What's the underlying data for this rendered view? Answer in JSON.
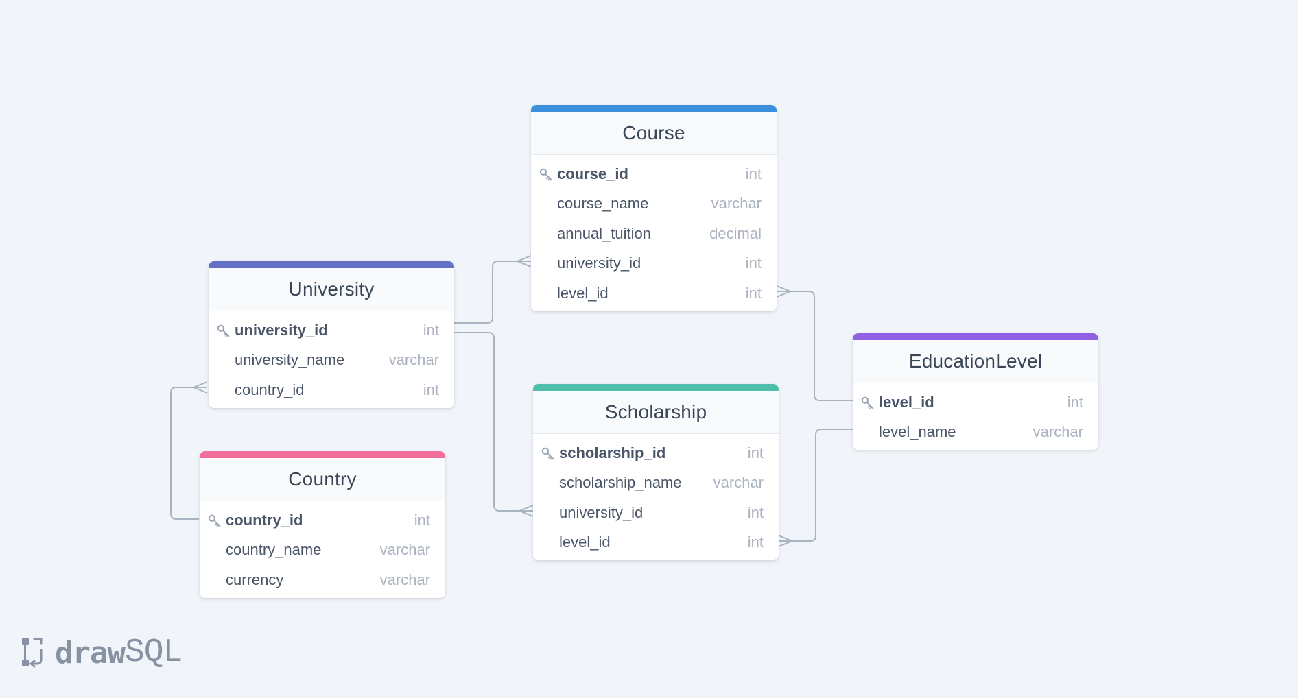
{
  "brand": {
    "name_bold": "draw",
    "name_light": "SQL"
  },
  "colors": {
    "course": "#3b8fdd",
    "university": "#6470c6",
    "scholarship": "#4fbfaa",
    "country": "#f26f9b",
    "educationlevel": "#9161e3",
    "connector": "#a9b4c2"
  },
  "tables": {
    "course": {
      "name": "Course",
      "columns": [
        {
          "name": "course_id",
          "type": "int",
          "pk": true
        },
        {
          "name": "course_name",
          "type": "varchar",
          "pk": false
        },
        {
          "name": "annual_tuition",
          "type": "decimal",
          "pk": false
        },
        {
          "name": "university_id",
          "type": "int",
          "pk": false
        },
        {
          "name": "level_id",
          "type": "int",
          "pk": false
        }
      ]
    },
    "university": {
      "name": "University",
      "columns": [
        {
          "name": "university_id",
          "type": "int",
          "pk": true
        },
        {
          "name": "university_name",
          "type": "varchar",
          "pk": false
        },
        {
          "name": "country_id",
          "type": "int",
          "pk": false
        }
      ]
    },
    "scholarship": {
      "name": "Scholarship",
      "columns": [
        {
          "name": "scholarship_id",
          "type": "int",
          "pk": true
        },
        {
          "name": "scholarship_name",
          "type": "varchar",
          "pk": false
        },
        {
          "name": "university_id",
          "type": "int",
          "pk": false
        },
        {
          "name": "level_id",
          "type": "int",
          "pk": false
        }
      ]
    },
    "country": {
      "name": "Country",
      "columns": [
        {
          "name": "country_id",
          "type": "int",
          "pk": true
        },
        {
          "name": "country_name",
          "type": "varchar",
          "pk": false
        },
        {
          "name": "currency",
          "type": "varchar",
          "pk": false
        }
      ]
    },
    "educationlevel": {
      "name": "EducationLevel",
      "columns": [
        {
          "name": "level_id",
          "type": "int",
          "pk": true
        },
        {
          "name": "level_name",
          "type": "varchar",
          "pk": false
        }
      ]
    }
  },
  "relations": [
    {
      "from_table": "university",
      "from_column": "university_id",
      "to_table": "course",
      "to_column": "university_id",
      "cardinality": "one-to-many"
    },
    {
      "from_table": "university",
      "from_column": "university_id",
      "to_table": "scholarship",
      "to_column": "university_id",
      "cardinality": "one-to-many"
    },
    {
      "from_table": "country",
      "from_column": "country_id",
      "to_table": "university",
      "to_column": "country_id",
      "cardinality": "one-to-many"
    },
    {
      "from_table": "educationlevel",
      "from_column": "level_id",
      "to_table": "course",
      "to_column": "level_id",
      "cardinality": "one-to-many"
    },
    {
      "from_table": "educationlevel",
      "from_column": "level_id",
      "to_table": "scholarship",
      "to_column": "level_id",
      "cardinality": "one-to-many"
    }
  ]
}
